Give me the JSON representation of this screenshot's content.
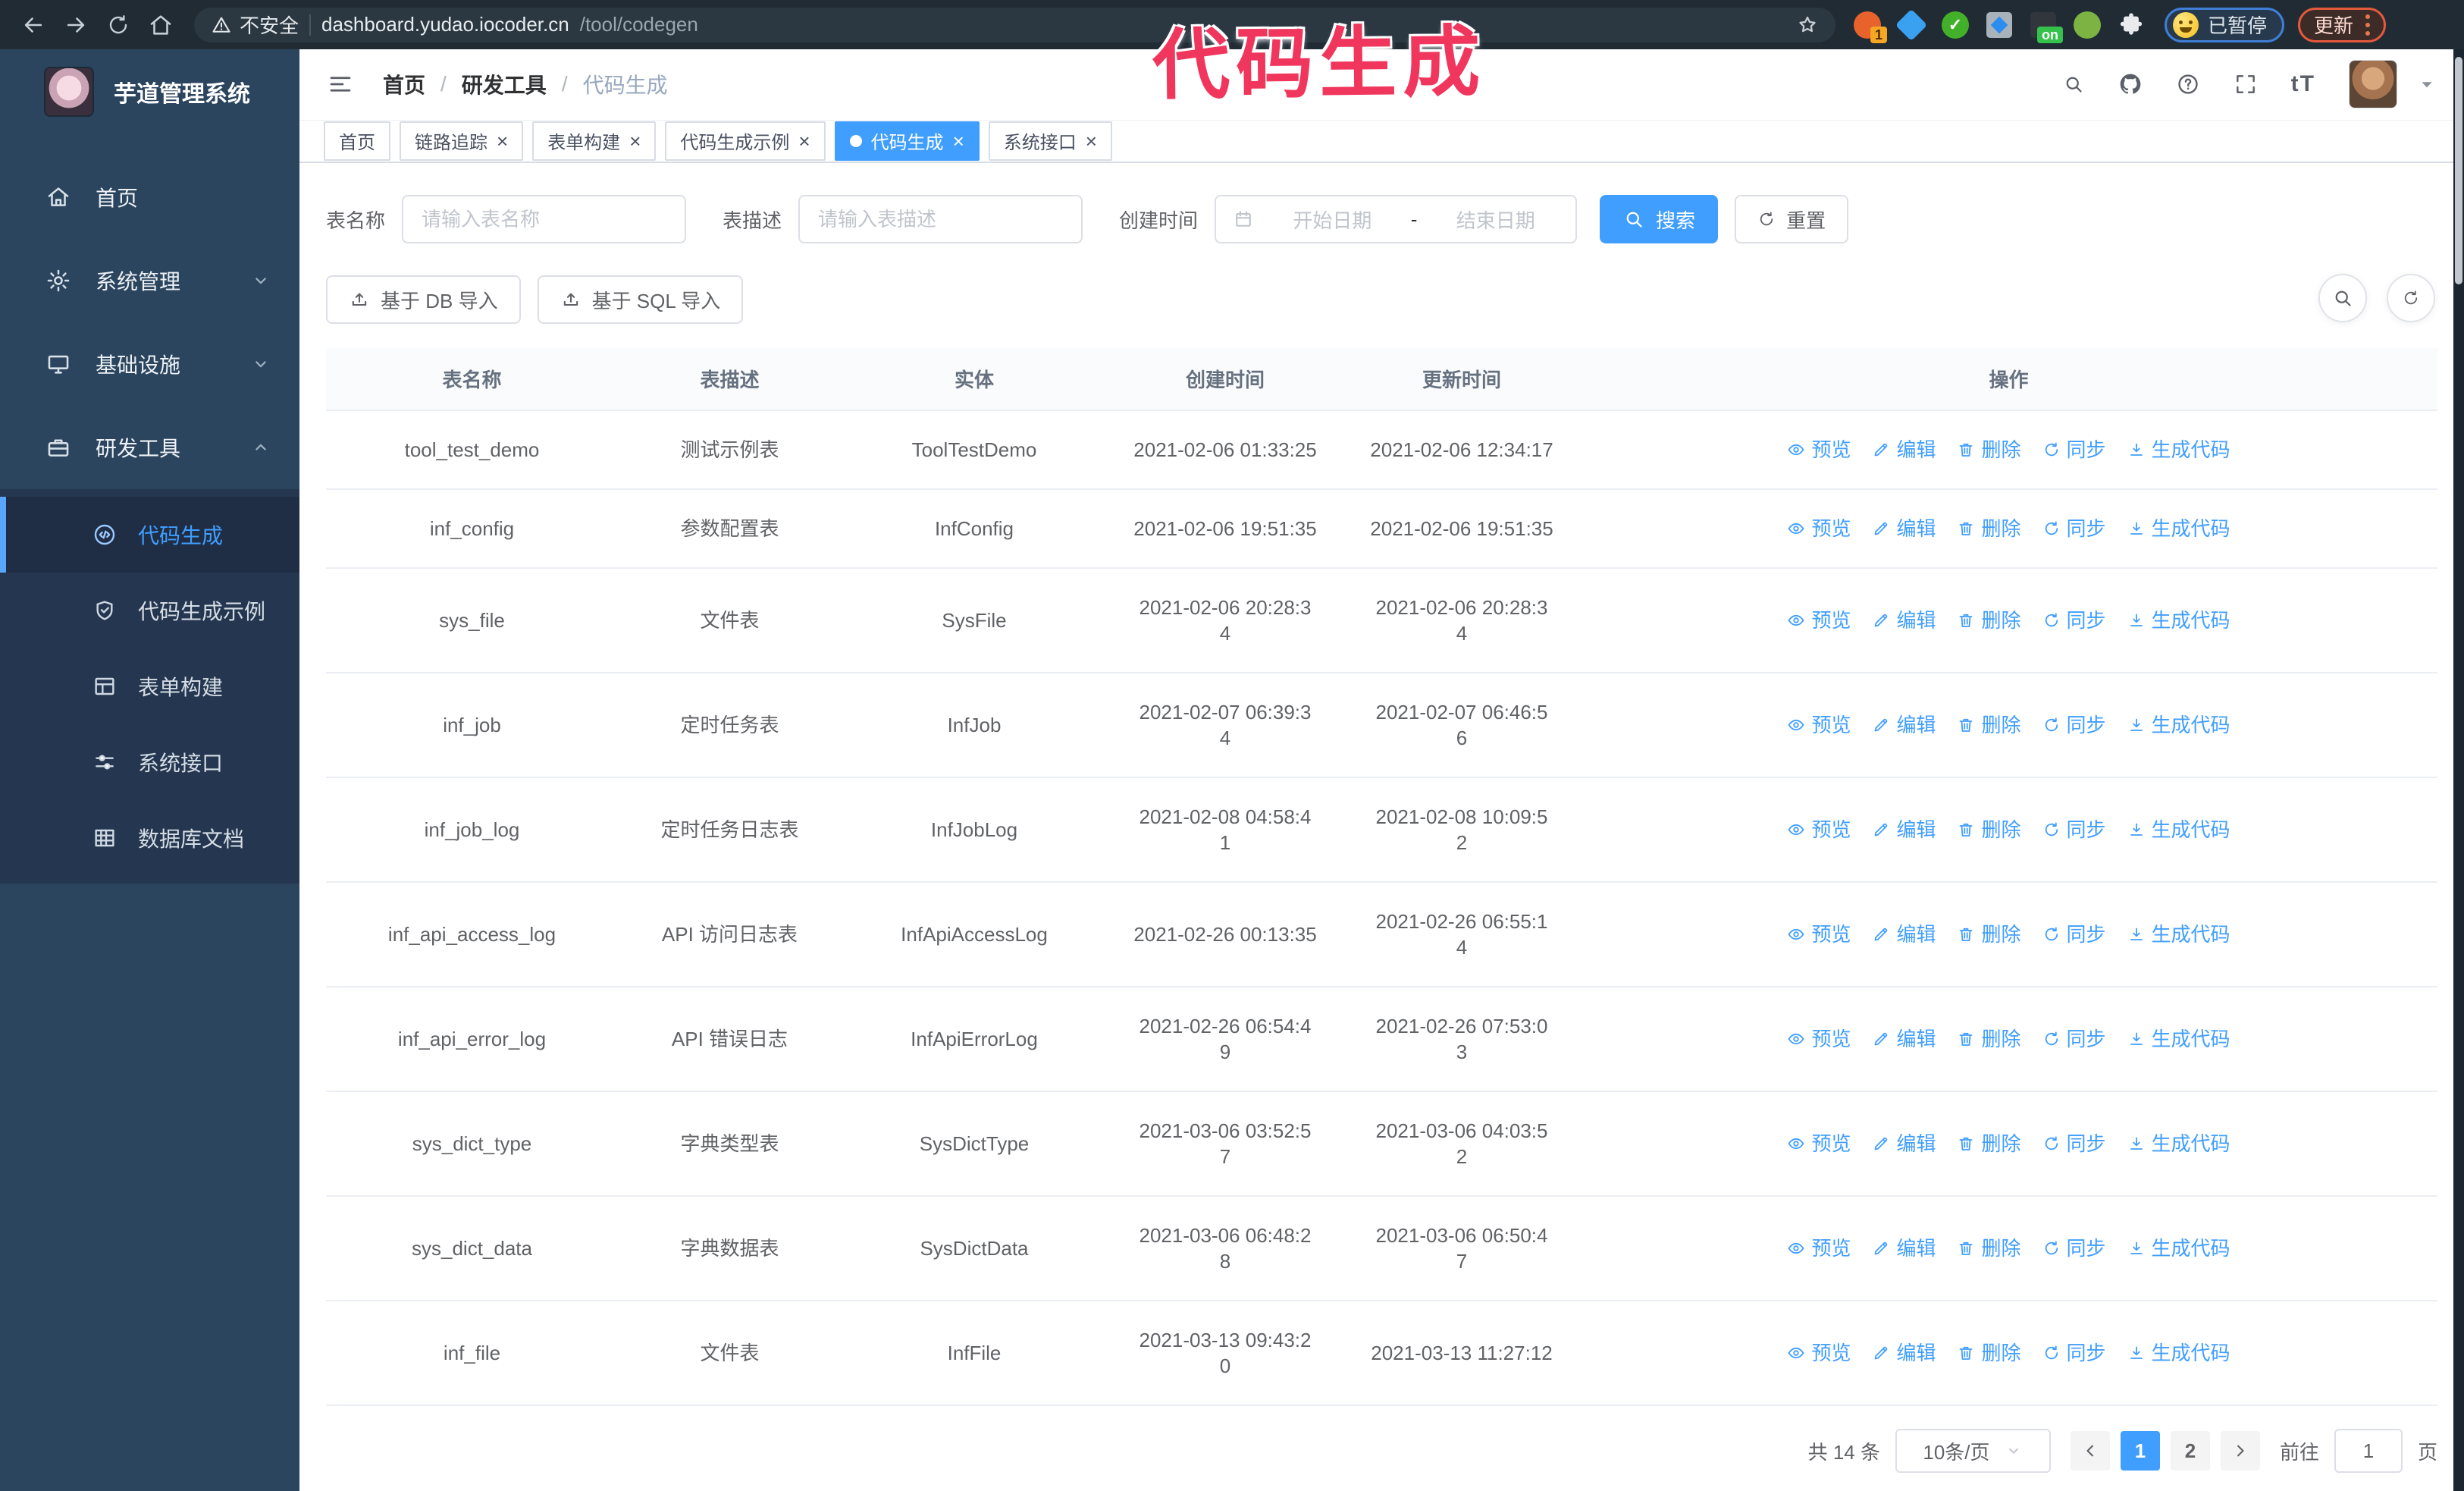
{
  "browser": {
    "security_warning": "不安全",
    "url_host": "dashboard.yudao.iocoder.cn",
    "url_path": "/tool/codegen",
    "ext1_badge": "1",
    "ext_on_badge": "on",
    "paused_badge": "已暂停",
    "update_button": "更新"
  },
  "annotation": "代码生成",
  "sidebar": {
    "app_title": "芋道管理系统",
    "items": [
      {
        "label": "首页",
        "icon": "home",
        "chevron": ""
      },
      {
        "label": "系统管理",
        "icon": "gear",
        "chevron": "chevron-down"
      },
      {
        "label": "基础设施",
        "icon": "monitor",
        "chevron": "chevron-down"
      },
      {
        "label": "研发工具",
        "icon": "briefcase",
        "chevron": "chevron-up"
      }
    ],
    "submenu": [
      {
        "label": "代码生成",
        "icon": "code",
        "active": true
      },
      {
        "label": "代码生成示例",
        "icon": "shield-check",
        "active": false
      },
      {
        "label": "表单构建",
        "icon": "form",
        "active": false
      },
      {
        "label": "系统接口",
        "icon": "sliders",
        "active": false
      },
      {
        "label": "数据库文档",
        "icon": "database",
        "active": false
      }
    ]
  },
  "header": {
    "breadcrumb": [
      "首页",
      "研发工具",
      "代码生成"
    ]
  },
  "tabs": [
    {
      "label": "首页",
      "closable": false,
      "active": false
    },
    {
      "label": "链路追踪",
      "closable": true,
      "active": false
    },
    {
      "label": "表单构建",
      "closable": true,
      "active": false
    },
    {
      "label": "代码生成示例",
      "closable": true,
      "active": false
    },
    {
      "label": "代码生成",
      "closable": true,
      "active": true
    },
    {
      "label": "系统接口",
      "closable": true,
      "active": false
    }
  ],
  "filters": {
    "name_label": "表名称",
    "name_placeholder": "请输入表名称",
    "desc_label": "表描述",
    "desc_placeholder": "请输入表描述",
    "date_label": "创建时间",
    "date_start_placeholder": "开始日期",
    "date_separator": "-",
    "date_end_placeholder": "结束日期",
    "search_label": "搜索",
    "reset_label": "重置"
  },
  "toolbar": {
    "db_import_label": "基于 DB 导入",
    "sql_import_label": "基于 SQL 导入"
  },
  "table": {
    "columns": [
      "表名称",
      "表描述",
      "实体",
      "创建时间",
      "更新时间",
      "操作"
    ],
    "actions": [
      {
        "label": "预览",
        "icon": "eye"
      },
      {
        "label": "编辑",
        "icon": "edit"
      },
      {
        "label": "删除",
        "icon": "trash"
      },
      {
        "label": "同步",
        "icon": "sync"
      },
      {
        "label": "生成代码",
        "icon": "download"
      }
    ],
    "rows": [
      {
        "name": "tool_test_demo",
        "desc": "测试示例表",
        "entity": "ToolTestDemo",
        "created": "2021-02-06 01:33:25",
        "updated": "2021-02-06 12:34:17"
      },
      {
        "name": "inf_config",
        "desc": "参数配置表",
        "entity": "InfConfig",
        "created": "2021-02-06 19:51:35",
        "updated": "2021-02-06 19:51:35"
      },
      {
        "name": "sys_file",
        "desc": "文件表",
        "entity": "SysFile",
        "created": "2021-02-06 20:28:3\n4",
        "updated": "2021-02-06 20:28:3\n4"
      },
      {
        "name": "inf_job",
        "desc": "定时任务表",
        "entity": "InfJob",
        "created": "2021-02-07 06:39:3\n4",
        "updated": "2021-02-07 06:46:5\n6"
      },
      {
        "name": "inf_job_log",
        "desc": "定时任务日志表",
        "entity": "InfJobLog",
        "created": "2021-02-08 04:58:4\n1",
        "updated": "2021-02-08 10:09:5\n2"
      },
      {
        "name": "inf_api_access_log",
        "desc": "API 访问日志表",
        "entity": "InfApiAccessLog",
        "created": "2021-02-26 00:13:35",
        "updated": "2021-02-26 06:55:1\n4"
      },
      {
        "name": "inf_api_error_log",
        "desc": "API 错误日志",
        "entity": "InfApiErrorLog",
        "created": "2021-02-26 06:54:4\n9",
        "updated": "2021-02-26 07:53:0\n3"
      },
      {
        "name": "sys_dict_type",
        "desc": "字典类型表",
        "entity": "SysDictType",
        "created": "2021-03-06 03:52:5\n7",
        "updated": "2021-03-06 04:03:5\n2"
      },
      {
        "name": "sys_dict_data",
        "desc": "字典数据表",
        "entity": "SysDictData",
        "created": "2021-03-06 06:48:2\n8",
        "updated": "2021-03-06 06:50:4\n7"
      },
      {
        "name": "inf_file",
        "desc": "文件表",
        "entity": "InfFile",
        "created": "2021-03-13 09:43:2\n0",
        "updated": "2021-03-13 11:27:12"
      }
    ]
  },
  "pagination": {
    "total_label": "共 14 条",
    "page_size_label": "10条/页",
    "pages": [
      "1",
      "2"
    ],
    "active_page": "1",
    "goto_label": "前往",
    "goto_value": "1",
    "page_unit": "页"
  }
}
